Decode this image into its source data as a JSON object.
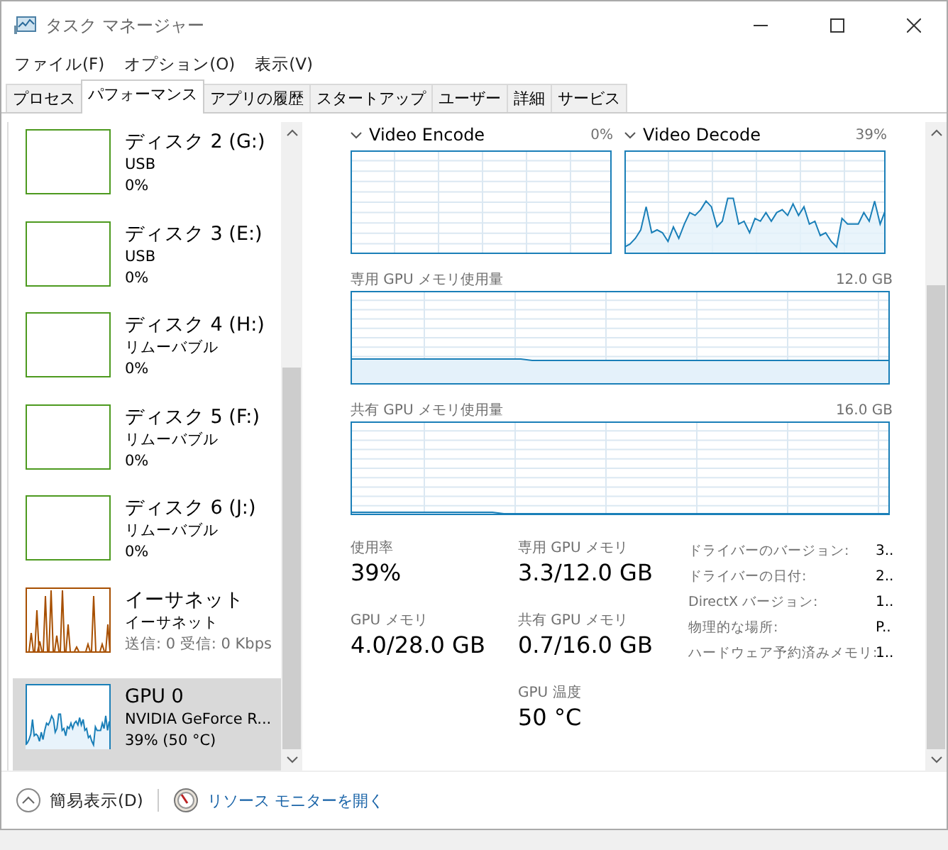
{
  "window": {
    "title": "タスク マネージャー"
  },
  "menu": [
    "ファイル(F)",
    "オプション(O)",
    "表示(V)"
  ],
  "tabs": [
    {
      "label": "プロセス",
      "selected": false
    },
    {
      "label": "パフォーマンス",
      "selected": true
    },
    {
      "label": "アプリの履歴",
      "selected": false
    },
    {
      "label": "スタートアップ",
      "selected": false
    },
    {
      "label": "ユーザー",
      "selected": false
    },
    {
      "label": "詳細",
      "selected": false
    },
    {
      "label": "サービス",
      "selected": false
    }
  ],
  "sidebar": {
    "items": [
      {
        "kind": "disk",
        "title": "ディスク 2 (G:)",
        "subtitle": "USB",
        "value": "0%",
        "selected": false
      },
      {
        "kind": "disk",
        "title": "ディスク 3 (E:)",
        "subtitle": "USB",
        "value": "0%",
        "selected": false
      },
      {
        "kind": "disk",
        "title": "ディスク 4 (H:)",
        "subtitle": "リムーバブル",
        "value": "0%",
        "selected": false
      },
      {
        "kind": "disk",
        "title": "ディスク 5 (F:)",
        "subtitle": "リムーバブル",
        "value": "0%",
        "selected": false
      },
      {
        "kind": "disk",
        "title": "ディスク 6 (J:)",
        "subtitle": "リムーバブル",
        "value": "0%",
        "selected": false
      },
      {
        "kind": "ethernet",
        "title": "イーサネット",
        "subtitle": "イーサネット",
        "value": "送信: 0 受信: 0 Kbps",
        "selected": false
      },
      {
        "kind": "gpu",
        "title": "GPU 0",
        "subtitle": "NVIDIA GeForce R...",
        "value": "39%  (50 °C)",
        "selected": true
      }
    ]
  },
  "engines": [
    {
      "label": "Video Encode",
      "value": "0%",
      "busy": false
    },
    {
      "label": "Video Decode",
      "value": "39%",
      "busy": true
    }
  ],
  "memory_graphs": [
    {
      "label": "専用 GPU メモリ使用量",
      "max": "12.0 GB"
    },
    {
      "label": "共有 GPU メモリ使用量",
      "max": "16.0 GB"
    }
  ],
  "stats": [
    [
      {
        "label": "使用率",
        "value": "39%"
      },
      {
        "label": "GPU メモリ",
        "value": "4.0/28.0 GB"
      }
    ],
    [
      {
        "label": "専用 GPU メモリ",
        "value": "3.3/12.0 GB"
      },
      {
        "label": "共有 GPU メモリ",
        "value": "0.7/16.0 GB"
      },
      {
        "label": "GPU 温度",
        "value": "50 °C"
      }
    ]
  ],
  "details": [
    {
      "label": "ドライバーのバージョン:",
      "value": "3.."
    },
    {
      "label": "ドライバーの日付:",
      "value": "2.."
    },
    {
      "label": "DirectX バージョン:",
      "value": "1.."
    },
    {
      "label": "物理的な場所:",
      "value": "P.."
    },
    {
      "label": "ハードウェア予約済みメモリ:",
      "value": "1.."
    }
  ],
  "footer": {
    "fewer_details": "簡易表示(D)",
    "resource_monitor": "リソース モニターを開く"
  }
}
